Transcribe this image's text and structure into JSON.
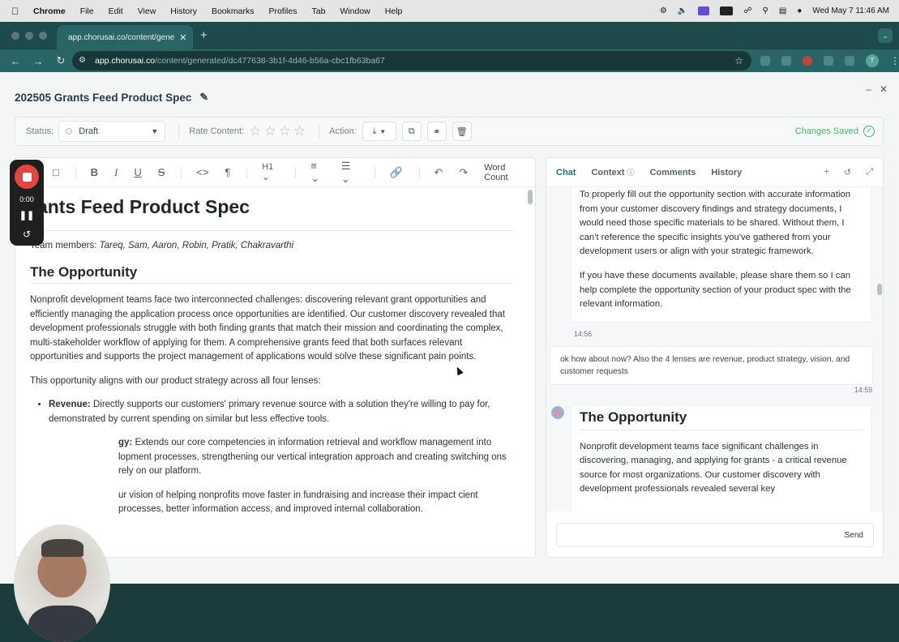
{
  "menubar": {
    "app": "Chrome",
    "items": [
      "File",
      "Edit",
      "View",
      "History",
      "Bookmarks",
      "Profiles",
      "Tab",
      "Window",
      "Help"
    ],
    "clock": "Wed May 7  11:46 AM"
  },
  "browser": {
    "tab_title": "app.chorusai.co/content/gene",
    "url_host": "app.chorusai.co",
    "url_path": "/content/generated/dc477638-3b1f-4d46-b56a-cbc1fb63ba67",
    "profile_initial": "T"
  },
  "doc": {
    "title": "202505 Grants Feed Product Spec"
  },
  "statusbar": {
    "status_label": "Status:",
    "status_value": "Draft",
    "rate_label": "Rate Content:",
    "rating": 0,
    "rating_max": 5,
    "action_label": "Action:",
    "saved_text": "Changes Saved"
  },
  "recorder": {
    "time": "0:00"
  },
  "editor": {
    "toolbar": {
      "heading": "H1",
      "word_count": "Word Count"
    },
    "h1": "rants Feed Product Spec",
    "team_label": "Team members: ",
    "team_names": "Tareq, Sam, Aaron, Robin, Pratik, Chakravarthi",
    "h2": "The Opportunity",
    "p1": "Nonprofit development teams face two interconnected challenges: discovering relevant grant opportunities and efficiently managing the application process once opportunities are identified. Our customer discovery revealed that development professionals struggle with both finding grants that match their mission and coordinating the complex, multi-stakeholder workflow of applying for them. A comprehensive grants feed that both surfaces relevant opportunities and supports the project management of applications would solve these significant pain points.",
    "p2": "This opportunity aligns with our product strategy across all four lenses:",
    "lenses": [
      {
        "label": "Revenue:",
        "text": " Directly supports our customers' primary revenue source with a solution they're willing to pay for, demonstrated by current spending on similar but less effective tools."
      },
      {
        "label": "gy:",
        "text": " Extends our core competencies in information retrieval and workflow management into lopment processes, strengthening our vertical integration approach and creating switching ons rely on our platform."
      },
      {
        "label": "",
        "text": "ur vision of helping nonprofits move faster in fundraising and increase their impact cient processes, better information access, and improved internal collaboration."
      }
    ]
  },
  "panel": {
    "tabs": [
      "Chat",
      "Context",
      "Comments",
      "History"
    ],
    "msg1_p1": "To properly fill out the opportunity section with accurate information from your customer discovery findings and strategy documents, I would need those specific materials to be shared. Without them, I can't reference the specific insights you've gathered from your development users or align with your strategic framework.",
    "msg1_p2": "If you have these documents available, please share them so I can help complete the opportunity section of your product spec with the relevant information.",
    "msg1_time": "14:56",
    "msg2": "ok how about now? Also the 4 lenses are revenue, product strategy, vision, and customer requests",
    "msg2_time": "14:59",
    "msg3_heading": "The Opportunity",
    "msg3_text": "Nonprofit development teams face significant challenges in discovering, managing, and applying for grants - a critical revenue source for most organizations. Our customer discovery with development professionals revealed several key",
    "input_placeholder": "",
    "send_label": "Send"
  }
}
